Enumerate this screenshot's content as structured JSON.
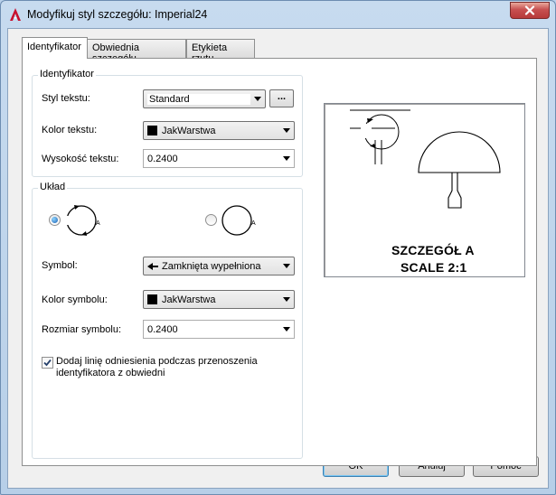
{
  "window": {
    "title": "Modyfikuj styl szczegółu: Imperial24",
    "icon": "autocad-app-icon",
    "close_icon": "close-icon"
  },
  "tabs": [
    {
      "label": "Identyfikator",
      "active": true
    },
    {
      "label": "Obwiednia szczegółu",
      "active": false
    },
    {
      "label": "Etykieta rzutu",
      "active": false
    }
  ],
  "identifier_group": {
    "title": "Identyfikator",
    "text_style_label": "Styl tekstu:",
    "text_style_value": "Standard",
    "browse_label": "...",
    "text_color_label": "Kolor tekstu:",
    "text_color_value": "JakWarstwa",
    "text_height_label": "Wysokość tekstu:",
    "text_height_value": "0.2400"
  },
  "layout_group": {
    "title": "Układ",
    "options": [
      {
        "letter": "A",
        "selected": true,
        "icon": "circle-with-arrows-icon"
      },
      {
        "letter": "A",
        "selected": false,
        "icon": "circle-icon"
      }
    ],
    "symbol_label": "Symbol:",
    "symbol_value": "Zamknięta wypełniona",
    "symbol_icon": "filled-arrow-icon",
    "symbol_color_label": "Kolor symbolu:",
    "symbol_color_value": "JakWarstwa",
    "symbol_size_label": "Rozmiar symbolu:",
    "symbol_size_value": "0.2400",
    "leader_checkbox_checked": true,
    "leader_checkbox_label_line1": "Dodaj linię odniesienia podczas przenoszenia",
    "leader_checkbox_label_line2": "identyfikatora z obwiedni"
  },
  "preview": {
    "line1": "SZCZEGÓŁ A",
    "line2": "SCALE 2:1"
  },
  "buttons": {
    "ok": "OK",
    "cancel": "Anuluj",
    "help": "Pomoc"
  },
  "colors": {
    "title_bar": "#b9d1ea",
    "close_button": "#c75050",
    "swatch": "#000000"
  }
}
